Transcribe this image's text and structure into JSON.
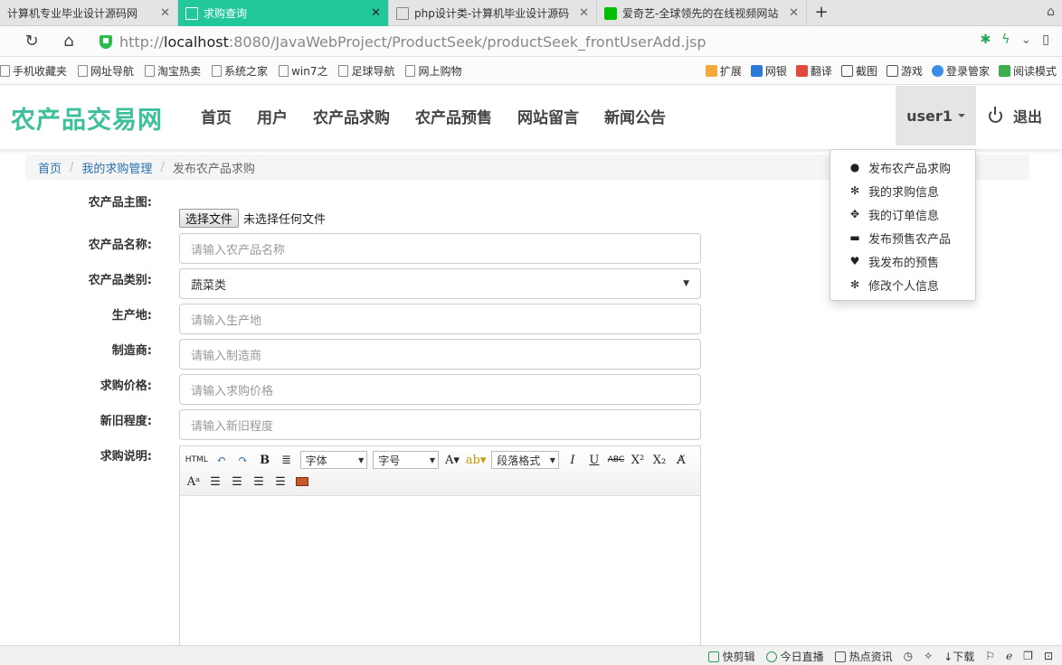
{
  "browser": {
    "tabs": [
      {
        "title": "计算机专业毕业设计源码网",
        "active": false
      },
      {
        "title": "求购查询",
        "active": true
      },
      {
        "title": "php设计类-计算机毕业设计源码",
        "active": false
      },
      {
        "title": "爱奇艺-全球领先的在线视频网站",
        "active": false
      }
    ],
    "new_tab": "+",
    "url_prefix": "http://",
    "url_host": "localhost",
    "url_rest": ":8080/JavaWebProject/ProductSeek/productSeek_frontUserAdd.jsp",
    "bookmarks": [
      "手机收藏夹",
      "网址导航",
      "淘宝热卖",
      "系统之家",
      "win7之",
      "足球导航",
      "网上购物"
    ],
    "toolbar_right": [
      "扩展",
      "网银",
      "翻译",
      "截图",
      "游戏",
      "登录管家",
      "阅读模式"
    ],
    "status_items": [
      "快剪辑",
      "今日直播",
      "热点资讯",
      "下载"
    ],
    "colors": {
      "active_tab": "#22c79a",
      "shield": "#2dbb4e"
    }
  },
  "site": {
    "brand": "农产品交易网",
    "nav": [
      "首页",
      "用户",
      "农产品求购",
      "农产品预售",
      "网站留言",
      "新闻公告"
    ],
    "user": "user1",
    "logout": "退出",
    "colors": {
      "brand": "#3cbf9a",
      "link": "#2a6fb0"
    }
  },
  "breadcrumb": {
    "items": [
      "首页",
      "我的求购管理"
    ],
    "current": "发布农产品求购"
  },
  "dropdown": {
    "items": [
      {
        "label": "发布农产品求购",
        "icon": "user-icon"
      },
      {
        "label": "我的求购信息",
        "icon": "gear-icon"
      },
      {
        "label": "我的订单信息",
        "icon": "move-icon"
      },
      {
        "label": "发布预售农产品",
        "icon": "credit-card-icon"
      },
      {
        "label": "我发布的预售",
        "icon": "heart-icon"
      },
      {
        "label": "修改个人信息",
        "icon": "gear-icon"
      }
    ]
  },
  "form": {
    "photo_label": "农产品主图:",
    "file_button": "选择文件",
    "file_status": "未选择任何文件",
    "name_label": "农产品名称:",
    "name_placeholder": "请输入农产品名称",
    "type_label": "农产品类别:",
    "type_value": "蔬菜类",
    "origin_label": "生产地:",
    "origin_placeholder": "请输入生产地",
    "maker_label": "制造商:",
    "maker_placeholder": "请输入制造商",
    "price_label": "求购价格:",
    "price_placeholder": "请输入求购价格",
    "condition_label": "新旧程度:",
    "condition_placeholder": "请输入新旧程度",
    "desc_label": "求购说明:"
  },
  "editor": {
    "html_btn": "HTML",
    "font_family": "字体",
    "font_size": "字号",
    "paragraph": "段落格式"
  }
}
